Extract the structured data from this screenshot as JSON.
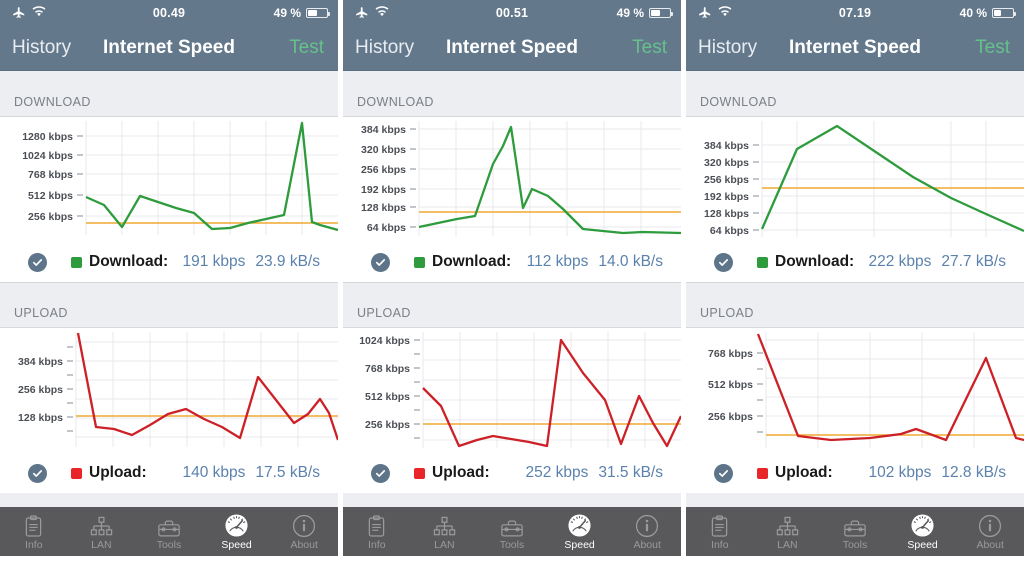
{
  "panels": [
    {
      "status": {
        "time": "00.49",
        "battery_pct": "49 %",
        "battery_level": 49,
        "airplane_icon": "airplane-icon",
        "wifi_icon": "wifi-icon"
      },
      "nav": {
        "left": "History",
        "title": "Internet Speed",
        "right": "Test"
      },
      "download": {
        "section": "DOWNLOAD",
        "check_icon": "checkmark-icon",
        "label": "Download:",
        "kbps": "191 kbps",
        "kbs": "23.9 kB/s",
        "color": "#2e9b3d"
      },
      "upload": {
        "section": "UPLOAD",
        "check_icon": "checkmark-icon",
        "label": "Upload:",
        "kbps": "140 kbps",
        "kbs": "17.5 kB/s",
        "color": "#e8262a"
      },
      "tabs": [
        {
          "label": "Info",
          "icon": "clipboard-icon",
          "active": false
        },
        {
          "label": "LAN",
          "icon": "network-icon",
          "active": false
        },
        {
          "label": "Tools",
          "icon": "toolbox-icon",
          "active": false
        },
        {
          "label": "Speed",
          "icon": "speedometer-icon",
          "active": true
        },
        {
          "label": "About",
          "icon": "info-circle-icon",
          "active": false
        }
      ]
    },
    {
      "status": {
        "time": "00.51",
        "battery_pct": "49 %",
        "battery_level": 49,
        "airplane_icon": "airplane-icon",
        "wifi_icon": "wifi-icon"
      },
      "nav": {
        "left": "History",
        "title": "Internet Speed",
        "right": "Test"
      },
      "download": {
        "section": "DOWNLOAD",
        "check_icon": "checkmark-icon",
        "label": "Download:",
        "kbps": "112 kbps",
        "kbs": "14.0 kB/s",
        "color": "#2e9b3d"
      },
      "upload": {
        "section": "UPLOAD",
        "check_icon": "checkmark-icon",
        "label": "Upload:",
        "kbps": "252 kbps",
        "kbs": "31.5 kB/s",
        "color": "#e8262a"
      },
      "tabs": [
        {
          "label": "Info",
          "icon": "clipboard-icon",
          "active": false
        },
        {
          "label": "LAN",
          "icon": "network-icon",
          "active": false
        },
        {
          "label": "Tools",
          "icon": "toolbox-icon",
          "active": false
        },
        {
          "label": "Speed",
          "icon": "speedometer-icon",
          "active": true
        },
        {
          "label": "About",
          "icon": "info-circle-icon",
          "active": false
        }
      ]
    },
    {
      "status": {
        "time": "07.19",
        "battery_pct": "40 %",
        "battery_level": 40,
        "airplane_icon": "airplane-icon",
        "wifi_icon": "wifi-icon"
      },
      "nav": {
        "left": "History",
        "title": "Internet Speed",
        "right": "Test"
      },
      "download": {
        "section": "DOWNLOAD",
        "check_icon": "checkmark-icon",
        "label": "Download:",
        "kbps": "222 kbps",
        "kbs": "27.7 kB/s",
        "color": "#2e9b3d"
      },
      "upload": {
        "section": "UPLOAD",
        "check_icon": "checkmark-icon",
        "label": "Upload:",
        "kbps": "102 kbps",
        "kbs": "12.8 kB/s",
        "color": "#e8262a"
      },
      "tabs": [
        {
          "label": "Info",
          "icon": "clipboard-icon",
          "active": false
        },
        {
          "label": "LAN",
          "icon": "network-icon",
          "active": false
        },
        {
          "label": "Tools",
          "icon": "toolbox-icon",
          "active": false
        },
        {
          "label": "Speed",
          "icon": "speedometer-icon",
          "active": true
        },
        {
          "label": "About",
          "icon": "info-circle-icon",
          "active": false
        }
      ]
    }
  ],
  "colors": {
    "navbar": "#64788c",
    "download_line": "#2e9b3d",
    "upload_line": "#cc2127",
    "average_line": "#f0a830",
    "tabbar": "#59595b",
    "tab_active_text": "#ffffff",
    "test_button": "#66c08a",
    "value_text": "#5b82ad"
  },
  "chart_data": [
    {
      "type": "line",
      "panel": 1,
      "title": "DOWNLOAD",
      "ylabel": "kbps",
      "ticks": [
        "256 kbps",
        "512 kbps",
        "768 kbps",
        "1024 kbps",
        "1280 kbps"
      ],
      "tick_values": [
        256,
        512,
        768,
        1024,
        1280
      ],
      "ylim": [
        64,
        1400
      ],
      "grid": true,
      "series": [
        {
          "name": "Download",
          "color": "#2e9b3d",
          "values": [
            500,
            340,
            175,
            500,
            430,
            360,
            290,
            165,
            170,
            205,
            245,
            295,
            1350,
            215,
            195,
            165
          ]
        }
      ],
      "average_line": {
        "value": 191,
        "label": "191 kbps",
        "color": "#f0a830"
      }
    },
    {
      "type": "line",
      "panel": 1,
      "title": "UPLOAD",
      "ylabel": "kbps",
      "ticks": [
        "128 kbps",
        "256 kbps",
        "384 kbps"
      ],
      "tick_values": [
        128,
        256,
        384
      ],
      "ylim": [
        40,
        470
      ],
      "grid": true,
      "series": [
        {
          "name": "Upload",
          "color": "#cc2127",
          "values": [
            450,
            105,
            100,
            88,
            110,
            135,
            150,
            125,
            105,
            80,
            305,
            210,
            110,
            140,
            225,
            160,
            78
          ]
        }
      ],
      "average_line": {
        "value": 140,
        "label": "140 kbps",
        "color": "#f0a830"
      }
    },
    {
      "type": "line",
      "panel": 2,
      "title": "DOWNLOAD",
      "ylabel": "kbps",
      "ticks": [
        "64 kbps",
        "128 kbps",
        "192 kbps",
        "256 kbps",
        "320 kbps",
        "384 kbps"
      ],
      "tick_values": [
        64,
        128,
        192,
        256,
        320,
        384
      ],
      "ylim": [
        40,
        400
      ],
      "grid": true,
      "series": [
        {
          "name": "Download",
          "color": "#2e9b3d",
          "values": [
            66,
            80,
            95,
            100,
            270,
            330,
            388,
            128,
            190,
            165,
            130,
            70,
            68,
            62,
            60,
            62
          ]
        }
      ],
      "average_line": {
        "value": 112,
        "label": "112 kbps",
        "color": "#f0a830"
      }
    },
    {
      "type": "line",
      "panel": 2,
      "title": "UPLOAD",
      "ylabel": "kbps",
      "ticks": [
        "256 kbps",
        "512 kbps",
        "768 kbps",
        "1024 kbps"
      ],
      "tick_values": [
        256,
        512,
        768,
        1024
      ],
      "ylim": [
        110,
        1090
      ],
      "grid": true,
      "series": [
        {
          "name": "Upload",
          "color": "#cc2127",
          "values": [
            545,
            350,
            130,
            175,
            200,
            180,
            150,
            130,
            1024,
            760,
            500,
            175,
            510,
            340,
            160,
            290
          ]
        }
      ],
      "average_line": {
        "value": 252,
        "label": "252 kbps",
        "color": "#f0a830"
      }
    },
    {
      "type": "line",
      "panel": 3,
      "title": "DOWNLOAD",
      "ylabel": "kbps",
      "ticks": [
        "64 kbps",
        "128 kbps",
        "192 kbps",
        "256 kbps",
        "320 kbps",
        "384 kbps"
      ],
      "tick_values": [
        64,
        128,
        192,
        256,
        320,
        384
      ],
      "ylim": [
        45,
        440
      ],
      "grid": true,
      "series": [
        {
          "name": "Download",
          "color": "#2e9b3d",
          "values": [
            68,
            370,
            430,
            330,
            250,
            175,
            100,
            62
          ]
        }
      ],
      "average_line": {
        "value": 222,
        "label": "222 kbps",
        "color": "#f0a830"
      }
    },
    {
      "type": "line",
      "panel": 3,
      "title": "UPLOAD",
      "ylabel": "kbps",
      "ticks": [
        "256 kbps",
        "512 kbps",
        "768 kbps"
      ],
      "tick_values": [
        256,
        512,
        768
      ],
      "ylim": [
        55,
        900
      ],
      "grid": true,
      "series": [
        {
          "name": "Upload",
          "color": "#cc2127",
          "values": [
            840,
            105,
            88,
            92,
            100,
            140,
            82,
            690,
            95
          ]
        }
      ],
      "average_line": {
        "value": 102,
        "label": "102 kbps",
        "color": "#f0a830"
      }
    }
  ]
}
